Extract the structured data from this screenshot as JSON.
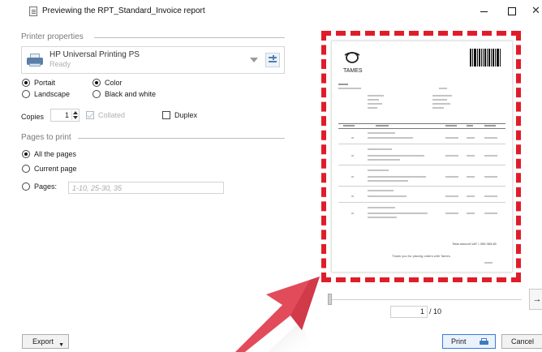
{
  "window": {
    "title": "Previewing the RPT_Standard_Invoice report"
  },
  "printer_properties": {
    "group_title": "Printer properties",
    "printer_name": "HP Universal Printing PS",
    "printer_status": "Ready",
    "orientation": {
      "portrait_label": "Portait",
      "landscape_label": "Landscape",
      "selected": "portrait"
    },
    "color_mode": {
      "color_label": "Color",
      "bw_label": "Black and white",
      "selected": "color"
    },
    "copies_label": "Copies",
    "copies_value": "1",
    "collated_label": "Collated",
    "collated_checked": true,
    "collated_enabled": false,
    "duplex_label": "Duplex",
    "duplex_checked": false
  },
  "pages_to_print": {
    "group_title": "Pages to print",
    "all_label": "All the pages",
    "current_label": "Current page",
    "pages_label": "Pages:",
    "pages_placeholder": "1-10, 25-30, 35",
    "selected": "all"
  },
  "preview": {
    "logo_text": "TAMES",
    "total_text": "Total amount VAT • 289 383,65",
    "thanks_text": "Thank you for placing orders with Tames",
    "current_page": "1",
    "page_total": "/ 10",
    "next_icon": "arrow-right-icon",
    "highlight_color": "#e01c2a"
  },
  "footer": {
    "export_label": "Export",
    "print_label": "Print",
    "cancel_label": "Cancel"
  },
  "annotation": {
    "arrow_color": "#e01c2a"
  }
}
